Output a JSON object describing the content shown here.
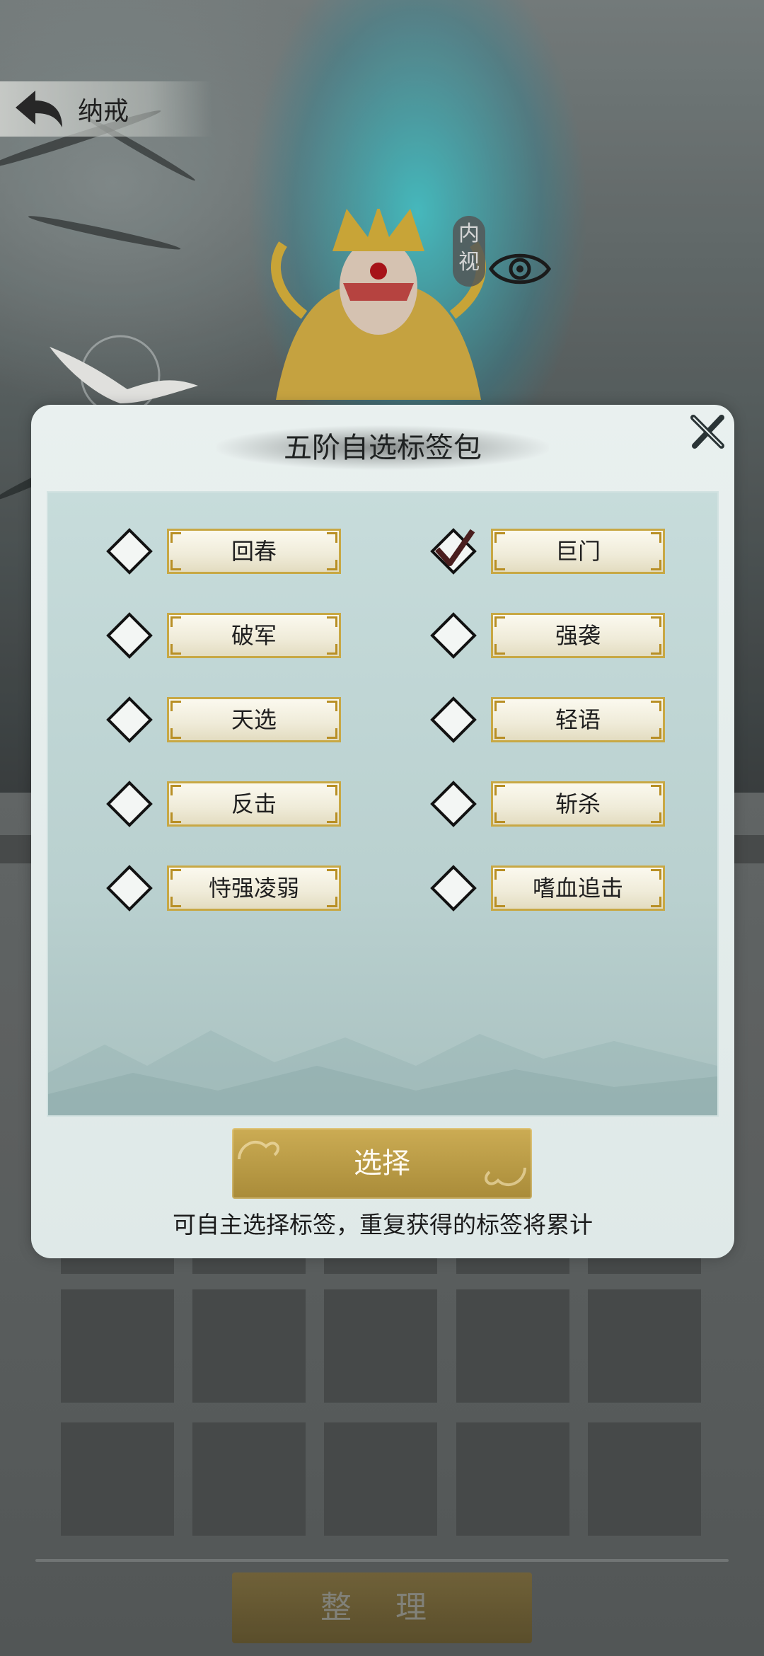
{
  "header": {
    "title": "纳戒",
    "back_icon": "back-arrow-icon"
  },
  "character_panel": {
    "inner_view_label": "内视",
    "eye_icon": "eye-icon"
  },
  "dialog": {
    "title": "五阶自选标签包",
    "close_icon": "close-x-icon",
    "tags": [
      {
        "label": "回春",
        "checked": false
      },
      {
        "label": "巨门",
        "checked": true
      },
      {
        "label": "破军",
        "checked": false
      },
      {
        "label": "强袭",
        "checked": false
      },
      {
        "label": "天选",
        "checked": false
      },
      {
        "label": "轻语",
        "checked": false
      },
      {
        "label": "反击",
        "checked": false
      },
      {
        "label": "斩杀",
        "checked": false
      },
      {
        "label": "恃强凌弱",
        "checked": false
      },
      {
        "label": "嗜血追击",
        "checked": false
      }
    ],
    "select_button_label": "选择",
    "hint": "可自主选择标签，重复获得的标签将累计"
  },
  "inventory": {
    "sort_button_label": "整 理"
  },
  "colors": {
    "gold_button": "#b89a45",
    "tag_border": "#c8a844",
    "panel_bg": "#c7dcdb"
  }
}
